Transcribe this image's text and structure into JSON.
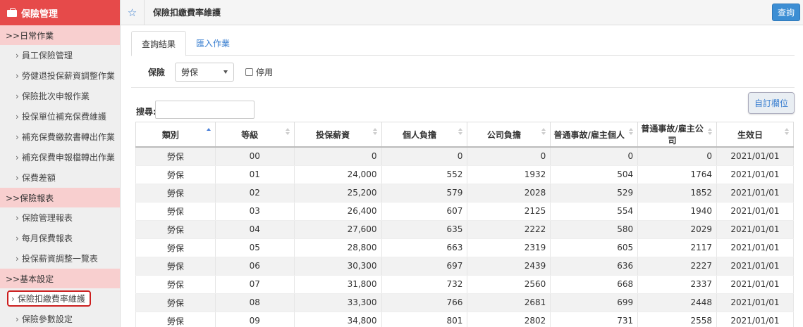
{
  "sidebar": {
    "header": "保險管理",
    "sections": [
      {
        "title": ">>日常作業",
        "items": [
          "員工保險管理",
          "勞健退投保薪資調整作業",
          "保險批次申報作業",
          "投保單位補充保費維護",
          "補充保費繳款書轉出作業",
          "補充保費申報檔轉出作業",
          "保費差額"
        ]
      },
      {
        "title": ">>保險報表",
        "items": [
          "保險管理報表",
          "每月保費報表",
          "投保薪資調整一覽表"
        ]
      },
      {
        "title": ">>基本設定",
        "items": [
          "保險扣繳費率維護",
          "保險參數設定"
        ]
      }
    ],
    "active_item": "保險扣繳費率維護",
    "chevron": "›"
  },
  "topbar": {
    "star": "☆",
    "title": "保險扣繳費率維護",
    "query_button": "查詢"
  },
  "tabs": [
    {
      "label": "查詢結果"
    },
    {
      "label": "匯入作業"
    }
  ],
  "filter": {
    "label": "保險",
    "select_value": "勞保",
    "checkbox_label": "停用"
  },
  "search": {
    "label": "搜尋:",
    "value": ""
  },
  "custom_columns_button": "自訂欄位",
  "table": {
    "headers": [
      "類別",
      "等級",
      "投保薪資",
      "個人負擔",
      "公司負擔",
      "普通事故/雇主個人",
      "普通事故/雇主公司",
      "生效日"
    ],
    "rows": [
      [
        "勞保",
        "00",
        "0",
        "0",
        "0",
        "0",
        "0",
        "2021/01/01"
      ],
      [
        "勞保",
        "01",
        "24,000",
        "552",
        "1932",
        "504",
        "1764",
        "2021/01/01"
      ],
      [
        "勞保",
        "02",
        "25,200",
        "579",
        "2028",
        "529",
        "1852",
        "2021/01/01"
      ],
      [
        "勞保",
        "03",
        "26,400",
        "607",
        "2125",
        "554",
        "1940",
        "2021/01/01"
      ],
      [
        "勞保",
        "04",
        "27,600",
        "635",
        "2222",
        "580",
        "2029",
        "2021/01/01"
      ],
      [
        "勞保",
        "05",
        "28,800",
        "663",
        "2319",
        "605",
        "2117",
        "2021/01/01"
      ],
      [
        "勞保",
        "06",
        "30,300",
        "697",
        "2439",
        "636",
        "2227",
        "2021/01/01"
      ],
      [
        "勞保",
        "07",
        "31,800",
        "732",
        "2560",
        "668",
        "2337",
        "2021/01/01"
      ],
      [
        "勞保",
        "08",
        "33,300",
        "766",
        "2681",
        "699",
        "2448",
        "2021/01/01"
      ],
      [
        "勞保",
        "09",
        "34,800",
        "801",
        "2802",
        "731",
        "2558",
        "2021/01/01"
      ]
    ]
  },
  "colors": {
    "brand_red": "#e64a4a",
    "section_pink": "#f8cfcf",
    "link_blue": "#3a7fd0",
    "button_blue": "#3c8ed4",
    "active_outline": "#cc1f1f"
  }
}
